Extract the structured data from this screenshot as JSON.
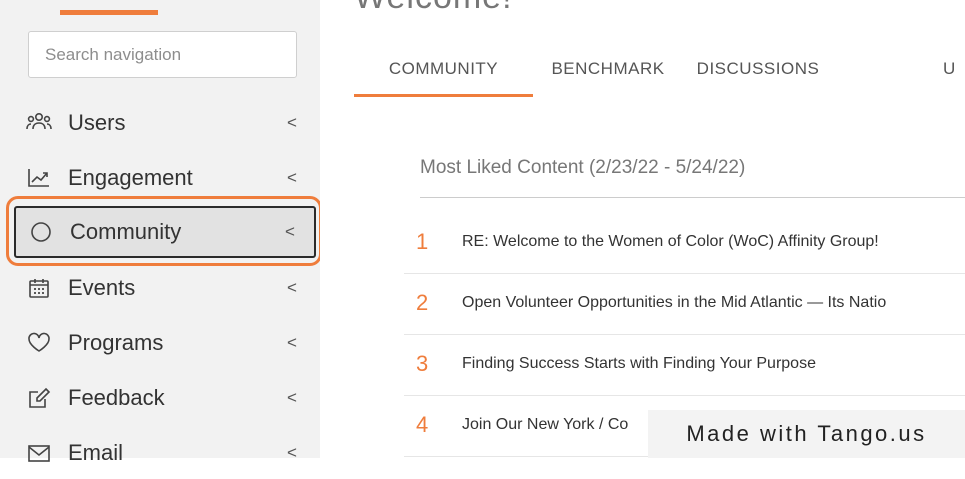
{
  "sidebar": {
    "search_placeholder": "Search navigation",
    "items": [
      {
        "label": "Users",
        "icon": "users-icon"
      },
      {
        "label": "Engagement",
        "icon": "chart-icon"
      },
      {
        "label": "Community",
        "icon": "circle-icon",
        "active": true
      },
      {
        "label": "Events",
        "icon": "calendar-icon"
      },
      {
        "label": "Programs",
        "icon": "heart-icon"
      },
      {
        "label": "Feedback",
        "icon": "edit-icon"
      },
      {
        "label": "Email",
        "icon": "mail-icon"
      }
    ],
    "chevron": "<"
  },
  "main": {
    "welcome": "Welcome!",
    "tabs": [
      "COMMUNITY",
      "BENCHMARK",
      "DISCUSSIONS",
      "U"
    ],
    "panel_title": "Most Liked Content (2/23/22 - 5/24/22)",
    "rows": [
      {
        "num": "1",
        "text": "RE: Welcome to the Women of Color (WoC) Affinity Group!"
      },
      {
        "num": "2",
        "text": "Open Volunteer Opportunities in the Mid Atlantic — Its Natio"
      },
      {
        "num": "3",
        "text": "Finding Success Starts with Finding Your Purpose"
      },
      {
        "num": "4",
        "text": "Join Our New York / Co"
      }
    ]
  },
  "watermark": "Made with Tango.us",
  "colors": {
    "accent": "#ef7d3c",
    "sidebar_bg": "#f2f2f2",
    "active_bg": "#e2e2e2"
  }
}
